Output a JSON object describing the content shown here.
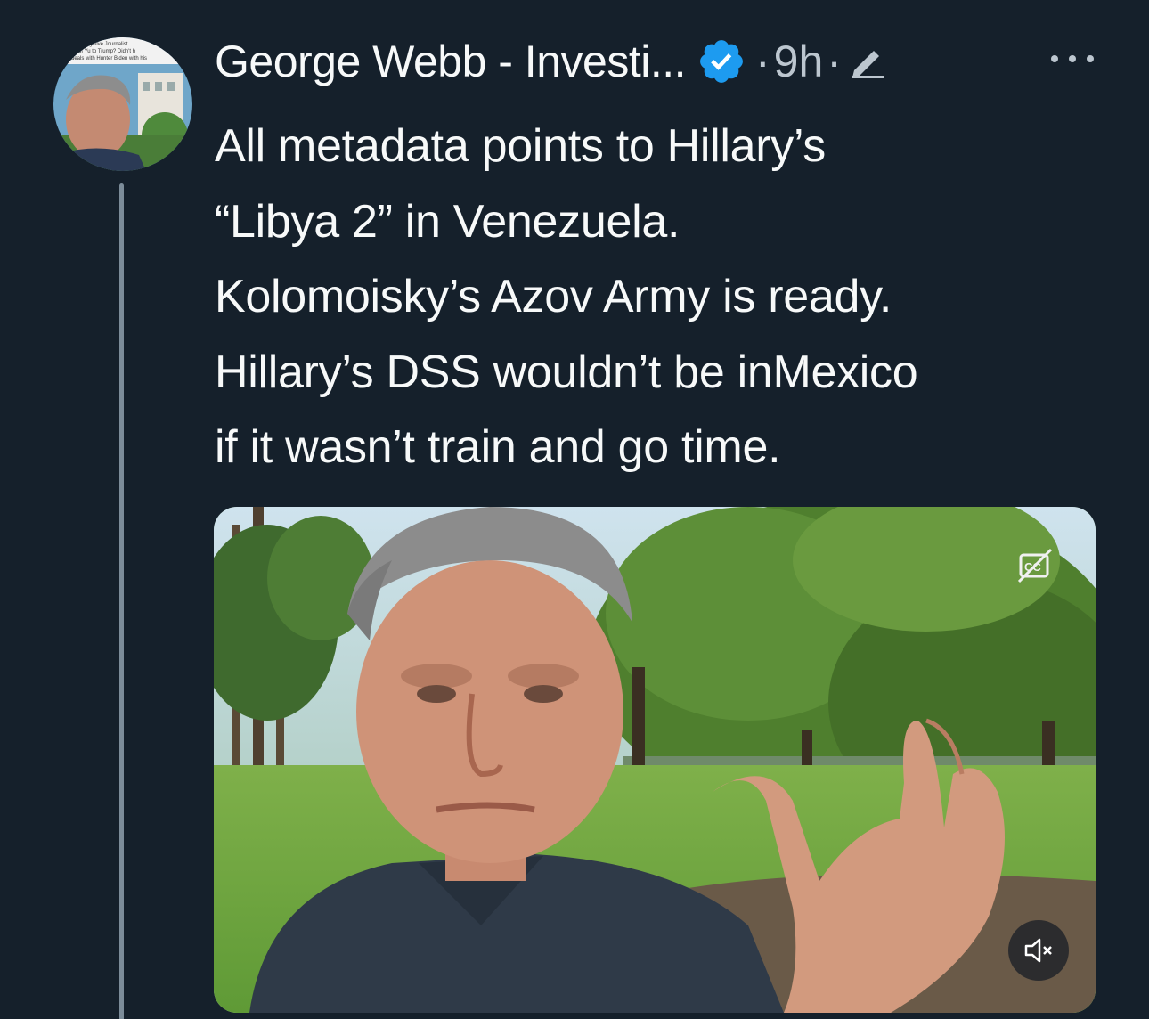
{
  "author": {
    "display_name": "George Webb - Investi...",
    "separator_1": "·",
    "time": "9h",
    "separator_2": "·",
    "avatar_text": [
      "gative Journalist",
      "me of Yu to Trump? Didn't h",
      "ns deals with Hunter Biden with his"
    ]
  },
  "tweet": {
    "lines": [
      "All metadata points to Hillary’s",
      "“Libya 2” in Venezuela.",
      "Kolomoisky’s Azov Army is ready.",
      "Hillary’s DSS wouldn’t be inMexico",
      "if it wasn’t train and go time."
    ]
  },
  "media": {
    "cc_icon": "closed-captions-off-icon",
    "mute_icon": "volume-muted-icon"
  },
  "icons": {
    "verified": "verified-badge-icon",
    "edit": "edited-pencil-icon",
    "more": "more-options-icon"
  },
  "colors": {
    "background": "#15202b",
    "text": "#f7f9f9",
    "secondary_text": "#bcc6cf",
    "verified_blue": "#1d9bf0",
    "thread_line": "#7c8c99"
  }
}
